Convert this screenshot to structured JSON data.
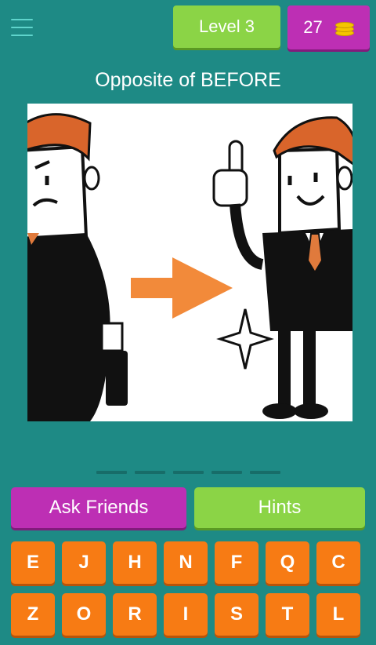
{
  "header": {
    "level_label": "Level 3",
    "coins": "27",
    "coin_icon": "coin-stack-icon"
  },
  "question": "Opposite of BEFORE",
  "image_description": "cartoon-before-after-businessman",
  "answer_slots": 5,
  "buttons": {
    "ask_friends": "Ask Friends",
    "hints": "Hints"
  },
  "keyboard": {
    "row1": [
      "E",
      "J",
      "H",
      "N",
      "F",
      "Q",
      "C"
    ],
    "row2": [
      "Z",
      "O",
      "R",
      "I",
      "S",
      "T",
      "L"
    ]
  },
  "colors": {
    "background": "#1e8a85",
    "green": "#8bd446",
    "purple": "#bd2fb4",
    "orange": "#f77b14"
  }
}
